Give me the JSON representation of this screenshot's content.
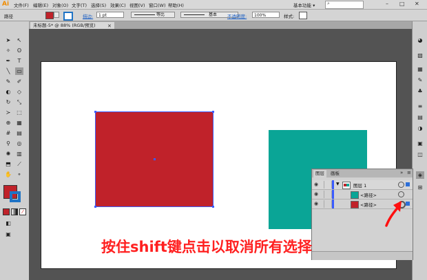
{
  "app": {
    "logo": "Ai"
  },
  "menubar": {
    "items": [
      "文件(F)",
      "编辑(E)",
      "对象(O)",
      "文字(T)",
      "选择(S)",
      "效果(C)",
      "视图(V)",
      "窗口(W)",
      "帮助(H)"
    ],
    "workspace": "基本功能 ▾",
    "window_controls": [
      "–",
      "□",
      "✕"
    ]
  },
  "control_bar": {
    "selection_label": "路径",
    "stroke_label": "描边:",
    "stroke_value": "1 pt",
    "stroke_profile": "等比",
    "brush": "基本",
    "opacity_label": "不透明度:",
    "opacity_value": "100%",
    "style_label": "样式:"
  },
  "document": {
    "tab_title": "未标题-5* @ 88% (RGB/预览)",
    "close": "✕"
  },
  "layers_panel": {
    "tabs": [
      "图层",
      "画板"
    ],
    "rows": [
      {
        "name": "图层 1",
        "thumb_color": "#ffffff"
      },
      {
        "name": "<路径>",
        "thumb_color": "#0aa596"
      },
      {
        "name": "<路径>",
        "thumb_color": "#c0222a"
      }
    ]
  },
  "caption": "按住shift键点击以取消所有选择",
  "colors": {
    "red": "#c0222a",
    "teal": "#0aa596",
    "selection": "#3b5cff",
    "caption": "#ff2020"
  },
  "icons": [
    "search-icon",
    "eye-icon",
    "arrow-icon"
  ]
}
